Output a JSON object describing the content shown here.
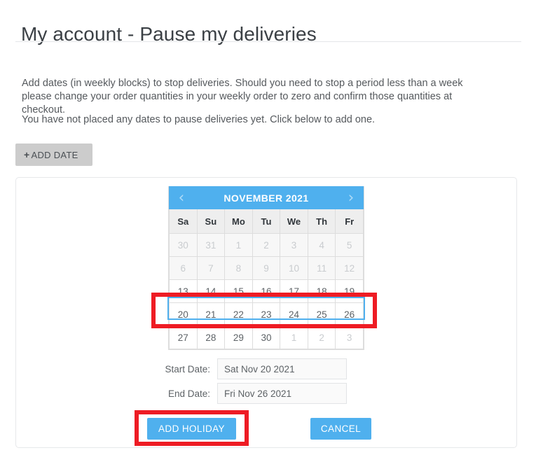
{
  "page": {
    "title": "My account - Pause my deliveries",
    "intro_1": "Add dates (in weekly blocks) to stop deliveries. Should you need to stop a period less than a week please change your order quantities in your weekly order to zero and confirm those quantities at checkout.",
    "intro_2": "You have not placed any dates to pause deliveries yet. Click below to add one."
  },
  "toolbar": {
    "add_date_plus": "+",
    "add_date_label": "ADD DATE"
  },
  "calendar": {
    "prev_icon": "‹",
    "next_icon": "›",
    "month_title": "NOVEMBER 2021",
    "weekdays": [
      "Sa",
      "Su",
      "Mo",
      "Tu",
      "We",
      "Th",
      "Fr"
    ],
    "weeks": [
      {
        "days": [
          "30",
          "31",
          "1",
          "2",
          "3",
          "4",
          "5"
        ],
        "state": "disabled"
      },
      {
        "days": [
          "6",
          "7",
          "8",
          "9",
          "10",
          "11",
          "12"
        ],
        "state": "disabled"
      },
      {
        "days": [
          "13",
          "14",
          "15",
          "16",
          "17",
          "18",
          "19"
        ],
        "state": "normal"
      },
      {
        "days": [
          "20",
          "21",
          "22",
          "23",
          "24",
          "25",
          "26"
        ],
        "state": "selected"
      },
      {
        "days": [
          "27",
          "28",
          "29",
          "30",
          "1",
          "2",
          "3"
        ],
        "state": "normal",
        "othermonth_from": 4
      }
    ]
  },
  "form": {
    "start_label": "Start Date:",
    "start_value": "Sat Nov 20 2021",
    "end_label": "End Date:",
    "end_value": "Fri Nov 26 2021"
  },
  "actions": {
    "add_holiday_label": "ADD HOLIDAY",
    "cancel_label": "CANCEL"
  },
  "colors": {
    "accent_blue": "#4fb0ee",
    "annotation_red": "#ee1c24",
    "button_grey": "#cccccc"
  }
}
